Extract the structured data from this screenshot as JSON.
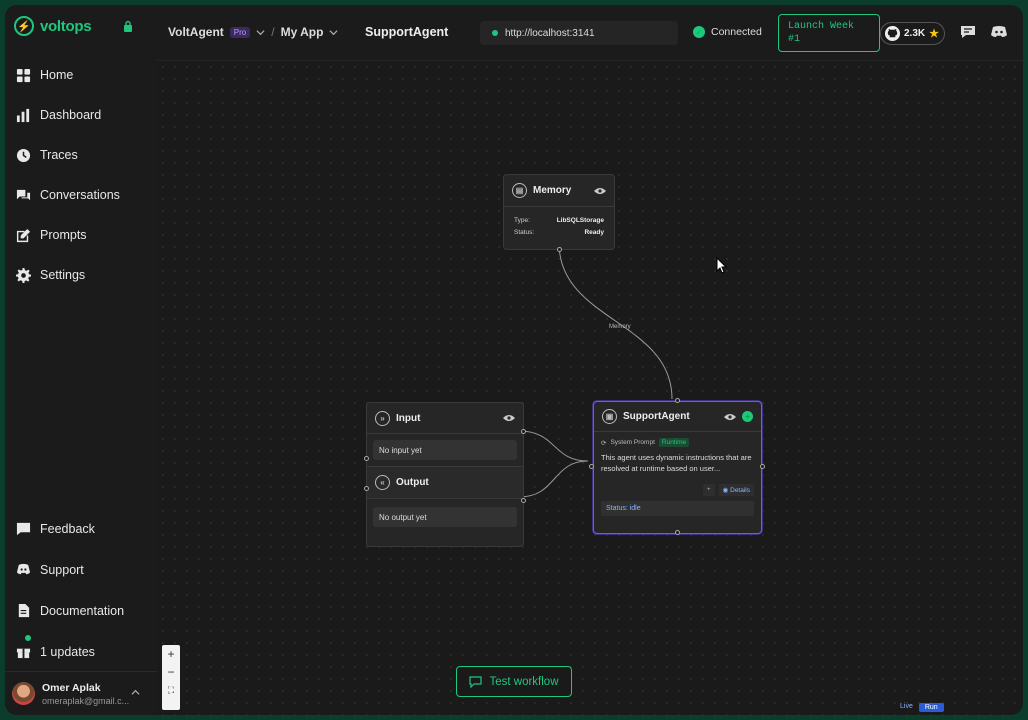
{
  "brand": {
    "name": "voltops"
  },
  "sidebar": {
    "items": [
      {
        "label": "Home",
        "icon": "home-icon"
      },
      {
        "label": "Dashboard",
        "icon": "bar-chart-icon"
      },
      {
        "label": "Traces",
        "icon": "clock-icon"
      },
      {
        "label": "Conversations",
        "icon": "chat-bubbles-icon"
      },
      {
        "label": "Prompts",
        "icon": "edit-icon"
      },
      {
        "label": "Settings",
        "icon": "gear-icon"
      }
    ],
    "bottom": [
      {
        "label": "Feedback",
        "icon": "feedback-icon"
      },
      {
        "label": "Support",
        "icon": "discord-icon"
      },
      {
        "label": "Documentation",
        "icon": "document-icon"
      },
      {
        "label": "1 updates",
        "icon": "gift-icon"
      }
    ],
    "user": {
      "name": "Omer Aplak",
      "email": "omeraplak@gmail.c..."
    }
  },
  "header": {
    "project": "VoltAgent",
    "plan_badge": "Pro",
    "separator": "/",
    "app": "My App",
    "agent_title": "SupportAgent",
    "url": "http://localhost:3141",
    "connection_status": "Connected",
    "launch_line1": "Launch Week",
    "launch_line2": "#1",
    "github_stars": "2.3K"
  },
  "canvas": {
    "memory_node": {
      "title": "Memory",
      "type_label": "Type:",
      "type_value": "LibSQLStorage",
      "status_label": "Status:",
      "status_value": "Ready"
    },
    "edge_label": "Memory",
    "input_node": {
      "title": "Input",
      "placeholder": "No input yet"
    },
    "output_node": {
      "title": "Output",
      "placeholder": "No output yet"
    },
    "agent_node": {
      "title": "SupportAgent",
      "prompt_label": "System Prompt",
      "prompt_badge": "Runtime",
      "description": "This agent uses dynamic instructions that are resolved at runtime based on user...",
      "plus_label": "+",
      "details_label": "Details",
      "status": "Status: idle"
    },
    "test_button": "Test workflow",
    "live_label": "Live",
    "run_label": "Run"
  },
  "colors": {
    "accent": "#1fc77e",
    "selected_node_border": "#6c5ce7",
    "background": "#1a1a1a"
  }
}
